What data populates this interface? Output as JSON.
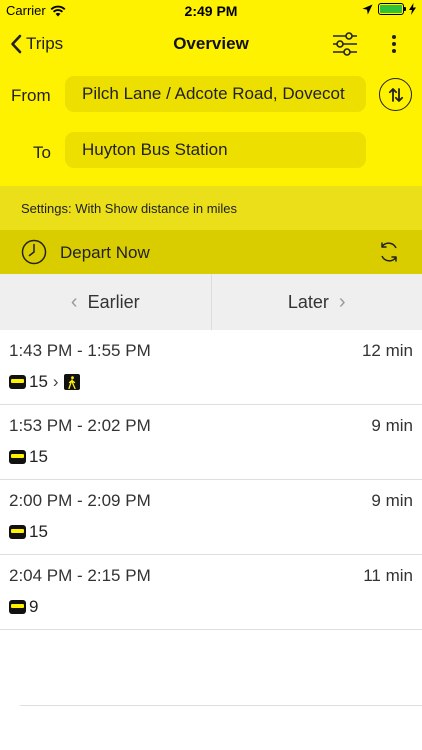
{
  "status_bar": {
    "carrier": "Carrier",
    "time": "2:49 PM"
  },
  "nav": {
    "back_label": "Trips",
    "title": "Overview"
  },
  "locations": {
    "from_label": "From",
    "from_value": "Pilch Lane / Adcote Road, Dovecot",
    "to_label": "To",
    "to_value": "Huyton Bus Station"
  },
  "settings": {
    "text": "Settings:  With Show distance in miles"
  },
  "depart": {
    "label": "Depart Now"
  },
  "time_nav": {
    "earlier": "Earlier",
    "later": "Later"
  },
  "trips": [
    {
      "time": "1:43 PM - 1:55 PM",
      "duration": "12 min",
      "route": "15",
      "walk": true
    },
    {
      "time": "1:53 PM - 2:02 PM",
      "duration": "9 min",
      "route": "15",
      "walk": false
    },
    {
      "time": "2:00 PM - 2:09 PM",
      "duration": "9 min",
      "route": "15",
      "walk": false
    },
    {
      "time": "2:04 PM - 2:15 PM",
      "duration": "11 min",
      "route": "9",
      "walk": false
    }
  ],
  "colors": {
    "header_yellow": "#fff200",
    "field_yellow": "#ede000",
    "settings_yellow": "#ebdf19",
    "depart_yellow": "#d9cd00",
    "battery_green": "#2fc13a"
  },
  "icons": [
    "wifi-icon",
    "location-arrow-icon",
    "battery-icon",
    "charging-icon",
    "chevron-left-icon",
    "filter-sliders-icon",
    "more-vertical-icon",
    "swap-icon",
    "clock-icon",
    "refresh-icon",
    "bus-icon",
    "walk-icon"
  ]
}
